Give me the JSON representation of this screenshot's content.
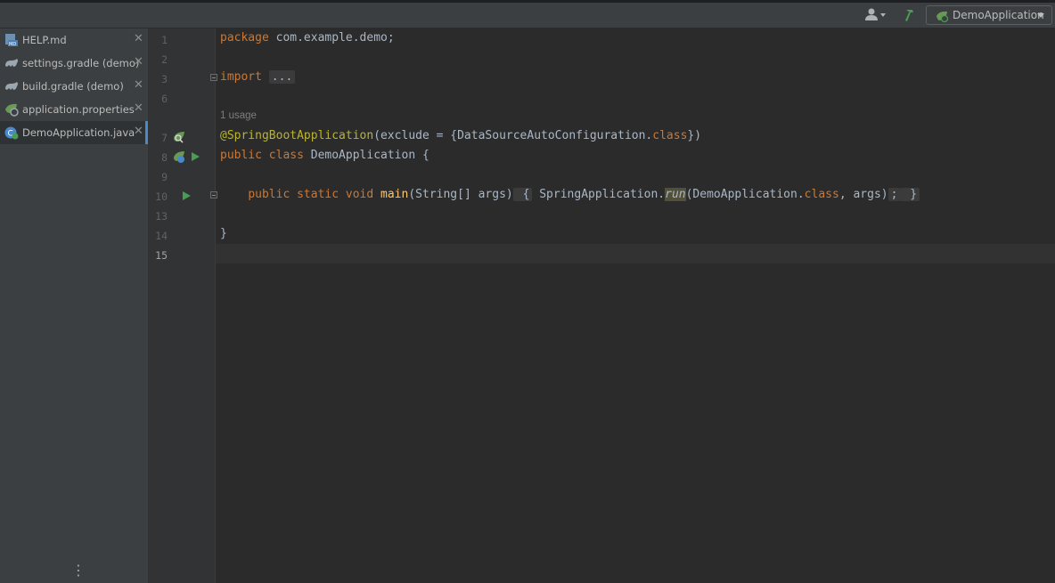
{
  "window": {
    "run_configuration": "DemoApplication"
  },
  "tabs": [
    {
      "name": "HELP.md",
      "icon": "markdown-icon"
    },
    {
      "name": "settings.gradle (demo)",
      "icon": "gradle-icon"
    },
    {
      "name": "build.gradle (demo)",
      "icon": "gradle-icon"
    },
    {
      "name": "application.properties",
      "icon": "spring-properties-icon"
    },
    {
      "name": "DemoApplication.java",
      "icon": "spring-class-icon",
      "active": true
    }
  ],
  "tab_close_glyph": "✕",
  "sidebar_more_glyph": "⋮",
  "editor": {
    "line_numbers": [
      "1",
      "2",
      "3",
      "6",
      "7",
      "8",
      "9",
      "10",
      "13",
      "14",
      "15"
    ],
    "current_line": "15",
    "usage_hint": "1 usage",
    "code": {
      "l1_kw": "package",
      "l1_rest": " com.example.demo;",
      "l3_kw": "import",
      "l3_fold": "...",
      "l7_ann": "@SpringBootApplication",
      "l7_a": "(exclude = {DataSourceAutoConfiguration.",
      "l7_kw": "class",
      "l7_b": "})",
      "l8_kw": "public class",
      "l8_rest": " DemoApplication {",
      "l10_kw": "public static void",
      "l10_fn": "main",
      "l10_a": "(String[] args)",
      "l10_brace_open": " {",
      "l10_b": " SpringApplication.",
      "l10_run": "run",
      "l10_c": "(DemoApplication.",
      "l10_kw2": "class",
      "l10_d": ", args)",
      "l10_semi": ";",
      "l10_brace_close": " }",
      "l14": "}"
    }
  },
  "colors": {
    "keyword": "#cc7832",
    "annotation": "#bbb529",
    "function": "#ffc66d",
    "text": "#a9b7c6",
    "run_green": "#499c54",
    "active_tab_accent": "#4a88c7"
  }
}
